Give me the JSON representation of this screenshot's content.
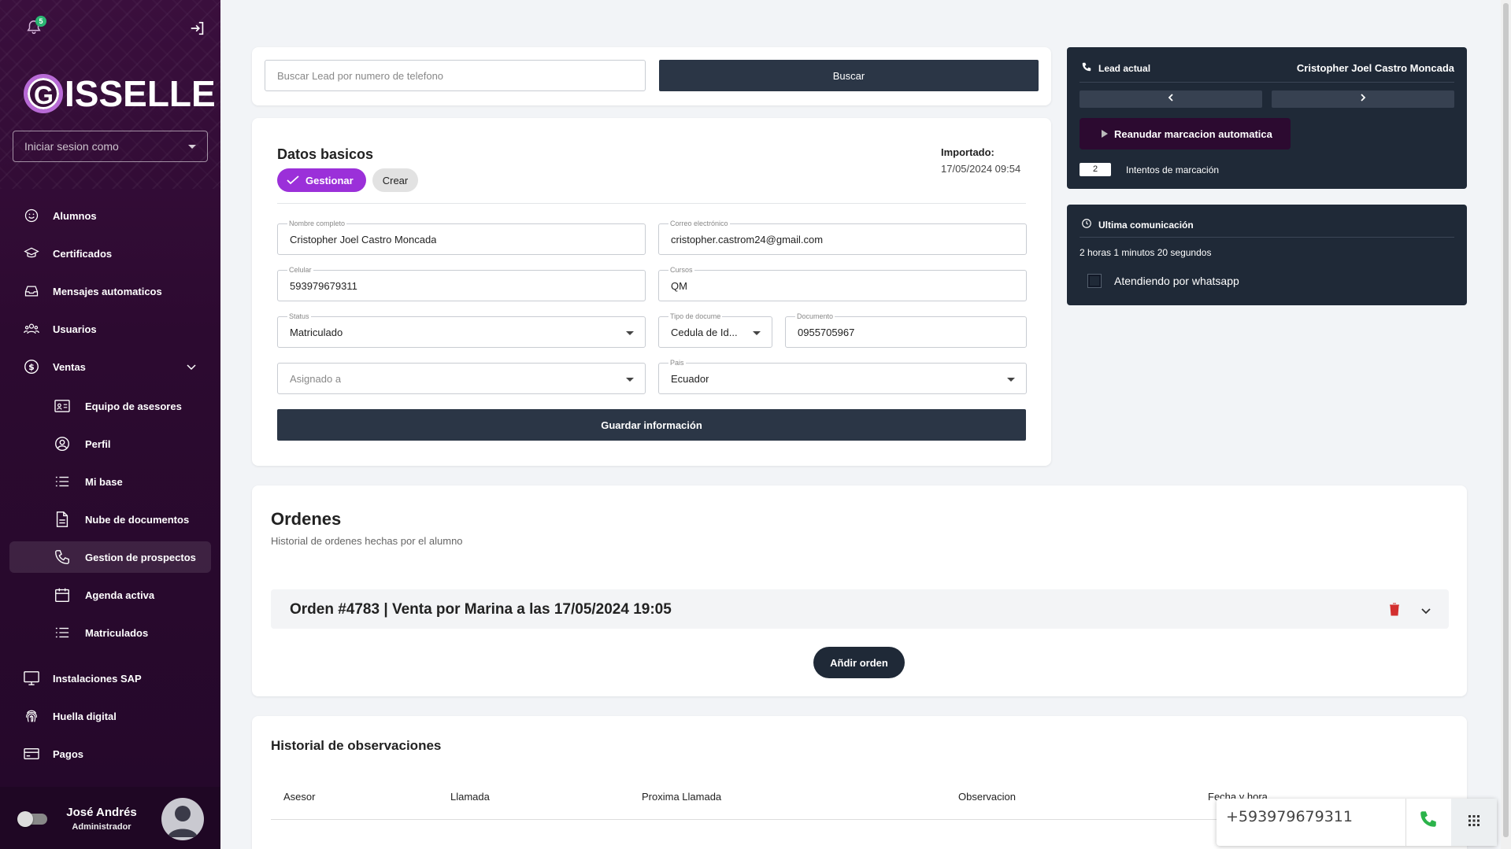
{
  "sidebar": {
    "notification_count": "5",
    "logo_text": "ISSELLE",
    "logo_letter": "G",
    "session_select_placeholder": "Iniciar sesion como",
    "items": [
      {
        "label": "Alumnos"
      },
      {
        "label": "Certificados"
      },
      {
        "label": "Mensajes automaticos"
      },
      {
        "label": "Usuarios"
      },
      {
        "label": "Ventas"
      },
      {
        "label": "Equipo de asesores"
      },
      {
        "label": "Perfil"
      },
      {
        "label": "Mi base"
      },
      {
        "label": "Nube de documentos"
      },
      {
        "label": "Gestion de prospectos"
      },
      {
        "label": "Agenda activa"
      },
      {
        "label": "Matriculados"
      },
      {
        "label": "Instalaciones SAP"
      },
      {
        "label": "Huella digital"
      },
      {
        "label": "Pagos"
      }
    ],
    "user": {
      "name": "José Andrés",
      "role": "Administrador"
    }
  },
  "search": {
    "placeholder": "Buscar Lead por numero de telefono",
    "button": "Buscar"
  },
  "datos": {
    "title": "Datos basicos",
    "chip_gestionar": "Gestionar",
    "chip_crear": "Crear",
    "imported_label": "Importado:",
    "imported_value": "17/05/2024 09:54",
    "fields": {
      "nombre": {
        "label": "Nombre completo",
        "value": "Cristopher Joel Castro Moncada"
      },
      "correo": {
        "label": "Correo electrónico",
        "value": "cristopher.castrom24@gmail.com"
      },
      "celular": {
        "label": "Celular",
        "value": "593979679311"
      },
      "cursos": {
        "label": "Cursos",
        "value": "QM"
      },
      "status": {
        "label": "Status",
        "value": "Matriculado"
      },
      "tipo": {
        "label": "Tipo de docume",
        "value": "Cedula de Id..."
      },
      "documento": {
        "label": "Documento",
        "value": "0955705967"
      },
      "asignado": {
        "placeholder": "Asignado a"
      },
      "pais": {
        "label": "Pais",
        "value": "Ecuador"
      }
    },
    "save_button": "Guardar información"
  },
  "lead": {
    "label": "Lead actual",
    "name": "Cristopher Joel Castro Moncada",
    "resume_button": "Reanudar marcacion automatica",
    "attempts_value": "2",
    "attempts_label": "Intentos de marcación"
  },
  "ultima": {
    "title": "Ultima comunicación",
    "duration": "2 horas 1 minutos 20 segundos",
    "whatsapp_label": "Atendiendo por whatsapp"
  },
  "ordenes": {
    "title": "Ordenes",
    "subtitle": "Historial de ordenes hechas por el alumno",
    "order_title": "Orden #4783 | Venta por Marina a las 17/05/2024 19:05",
    "add_button": "Añdir orden"
  },
  "historial": {
    "title": "Historial de observaciones",
    "columns": [
      "Asesor",
      "Llamada",
      "Proxima Llamada",
      "Observacion",
      "Fecha y hora"
    ]
  },
  "dialer": {
    "number": "+593979679311"
  },
  "colors": {
    "sidebar": "#2c0a30",
    "accent_purple": "#9b30d9",
    "dark_panel": "#1f2937",
    "call_green": "#2bb34a",
    "delete_red": "#d32f2f"
  }
}
